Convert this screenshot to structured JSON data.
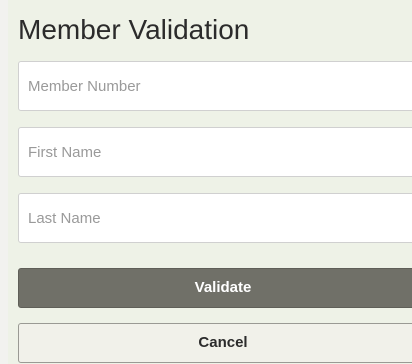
{
  "form": {
    "title": "Member Validation",
    "fields": {
      "member_number": {
        "value": "",
        "placeholder": "Member Number"
      },
      "first_name": {
        "value": "",
        "placeholder": "First Name"
      },
      "last_name": {
        "value": "",
        "placeholder": "Last Name"
      }
    },
    "buttons": {
      "validate_label": "Validate",
      "cancel_label": "Cancel"
    }
  },
  "colors": {
    "panel_background": "#eef2e7",
    "validate_background": "#707068",
    "cancel_background": "#f1f1ea"
  }
}
